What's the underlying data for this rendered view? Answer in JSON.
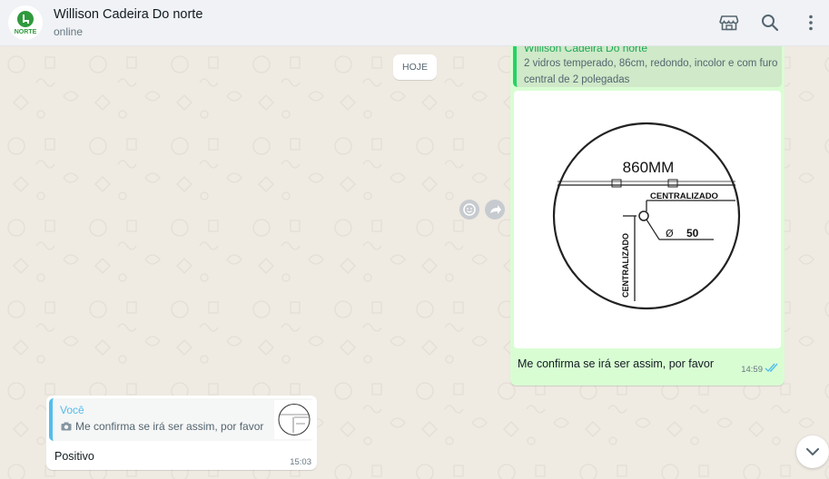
{
  "header": {
    "contact_name": "Willison Cadeira Do norte",
    "status": "online",
    "avatar_text": "NORTE",
    "icons": [
      "catalog-icon",
      "search-icon",
      "menu-icon"
    ]
  },
  "chat": {
    "date_divider": "HOJE",
    "outgoing": {
      "quoted_author": "Willison Cadeira Do norte",
      "quoted_text": "2 vidros temperado, 86cm, redondo, incolor e com furo central de 2 polegadas",
      "image_labels": {
        "diameter": "860MM",
        "centered_h": "CENTRALIZADO",
        "centered_v": "CENTRALIZADO",
        "hole_symbol": "Ø",
        "hole_size": "50"
      },
      "caption": "Me confirma se irá ser assim, por favor",
      "time": "14:59",
      "status": "read"
    },
    "incoming": {
      "quoted_author": "Você",
      "quoted_text": "Me confirma se irá ser assim, por favor",
      "text": "Positivo",
      "time": "15:03"
    }
  },
  "colors": {
    "outgoing_bubble": "#d9fdd3",
    "incoming_bubble": "#ffffff",
    "accent_green": "#25d366",
    "accent_blue": "#53bdeb",
    "background": "#efeae2"
  }
}
